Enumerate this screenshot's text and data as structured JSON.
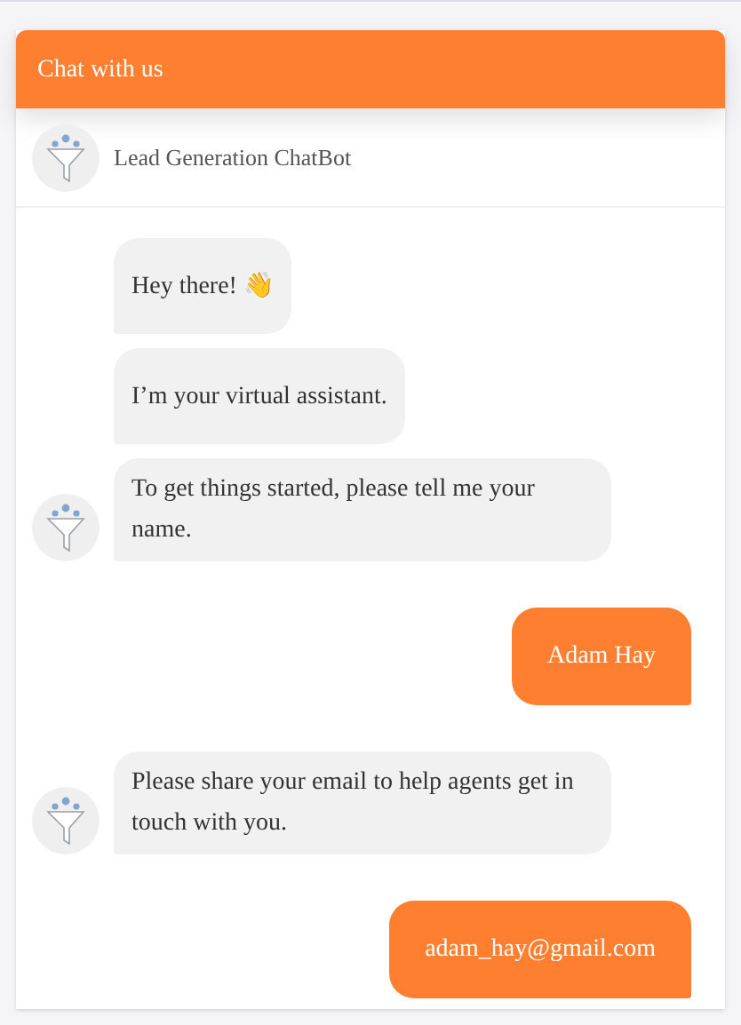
{
  "header": {
    "title": "Chat with us"
  },
  "bot": {
    "name": "Lead Generation ChatBot"
  },
  "messages": [
    {
      "kind": "bot",
      "text": "Hey there! 👋",
      "show_avatar": false
    },
    {
      "kind": "bot",
      "text": "I’m your virtual assistant.",
      "show_avatar": false
    },
    {
      "kind": "bot",
      "text": "To get things started, please tell me your name.",
      "show_avatar": true
    },
    {
      "kind": "user",
      "text": "Adam Hay"
    },
    {
      "kind": "bot",
      "text": "Please share your email to help agents get in touch with you.",
      "show_avatar": true
    },
    {
      "kind": "user",
      "text": "adam_hay@gmail.com"
    }
  ]
}
